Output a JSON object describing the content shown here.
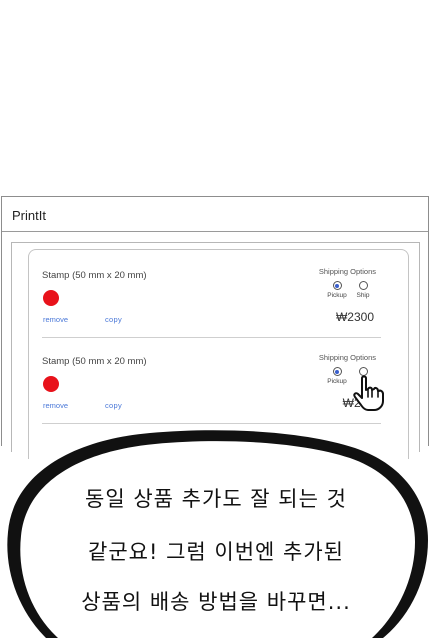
{
  "window": {
    "title": "PrintIt"
  },
  "cards": [
    {
      "product": "Stamp (50 mm x 20 mm)",
      "color": "#e8121b",
      "remove_label": "remove",
      "copy_label": "copy",
      "shipping_label": "Shipping Options",
      "options": [
        "Pickup",
        "Ship"
      ],
      "selected": "Pickup",
      "price": "₩2300"
    },
    {
      "product": "Stamp (50 mm x 20 mm)",
      "color": "#e8121b",
      "remove_label": "remove",
      "copy_label": "copy",
      "shipping_label": "Shipping Options",
      "options": [
        "Pickup",
        "Ship"
      ],
      "selected": "Pickup",
      "price": "₩230"
    }
  ],
  "bubble": {
    "line1": "동일 상품 추가도 잘 되는 것",
    "line2": "같군요! 그럼 이번엔 추가된",
    "line3": "상품의 배송 방법을 바꾸면..."
  },
  "cursor_icon": "hand-pointer-icon"
}
